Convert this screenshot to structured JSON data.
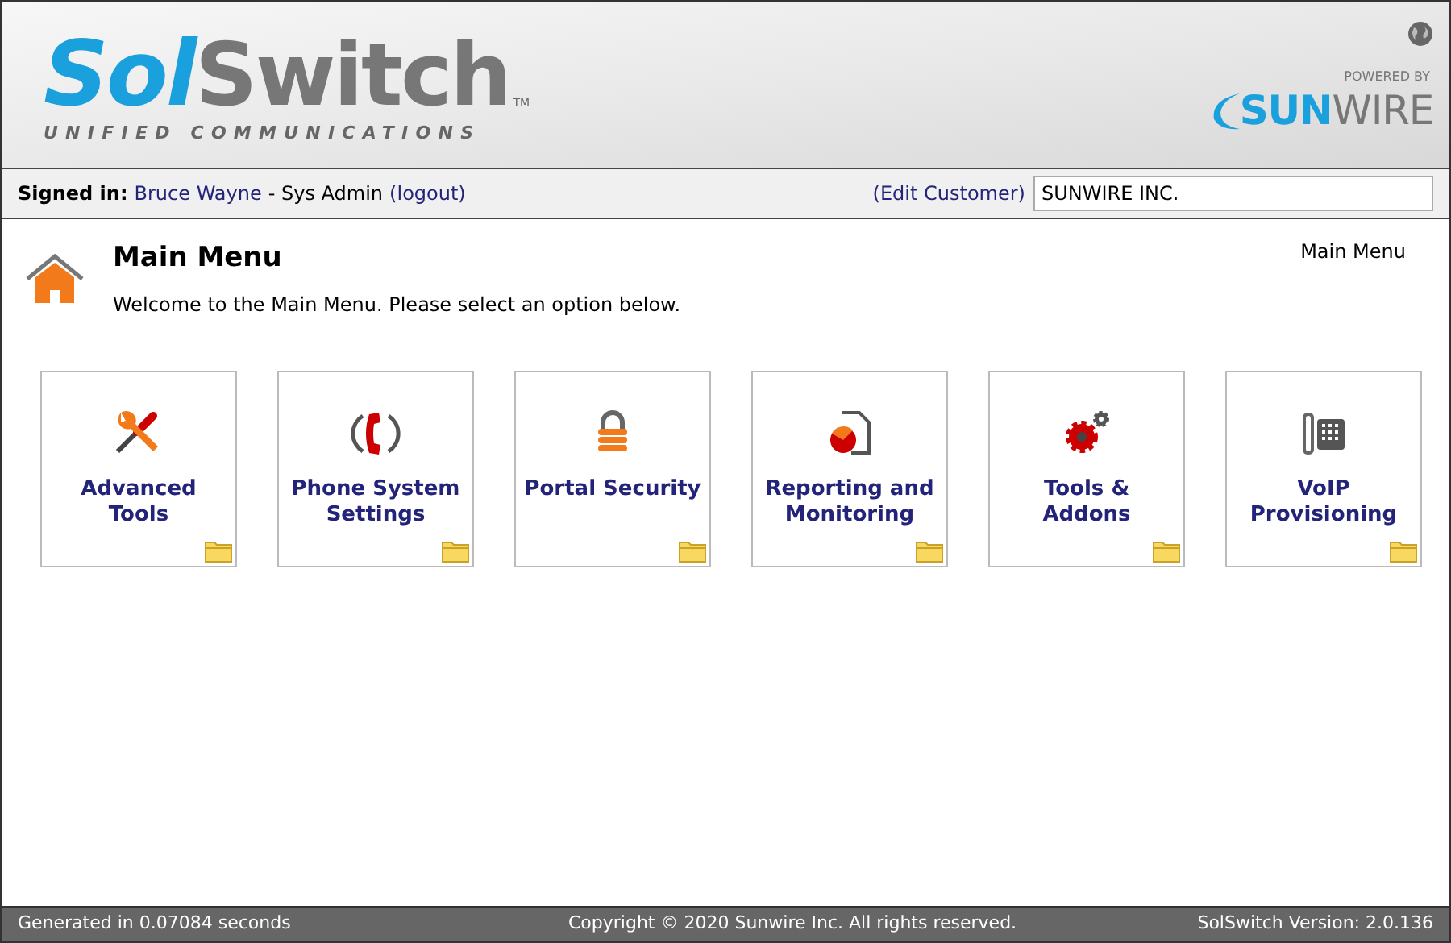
{
  "header": {
    "logo": {
      "sol": "Sol",
      "switch": "Switch",
      "trademark": "TM",
      "tagline": "UNIFIED COMMUNICATIONS"
    },
    "powered_by": {
      "label": "POWERED BY",
      "brand_bold": "SUN",
      "brand_light": "WIRE"
    }
  },
  "user_bar": {
    "signed_in_label": "Signed in:",
    "user": "Bruce Wayne",
    "role": "- Sys Admin",
    "logout": "(logout)",
    "edit_customer": "(Edit Customer)",
    "customer_field": {
      "value": "SUNWIRE INC."
    }
  },
  "page": {
    "title": "Main Menu",
    "subtitle": "Welcome to the Main Menu. Please select an option below.",
    "breadcrumb": "Main Menu"
  },
  "tiles": [
    {
      "label": "Advanced Tools",
      "kind": "tools"
    },
    {
      "label": "Phone System Settings",
      "kind": "phone"
    },
    {
      "label": "Portal Security",
      "kind": "lock"
    },
    {
      "label": "Reporting and Monitoring",
      "kind": "report"
    },
    {
      "label": "Tools & Addons",
      "kind": "gears"
    },
    {
      "label": "VoIP Provisioning",
      "kind": "deskphone"
    }
  ],
  "footer": {
    "left": "Generated in 0.07084 seconds",
    "center": "Copyright © 2020 Sunwire Inc. All rights reserved.",
    "right": "SolSwitch Version: 2.0.136"
  }
}
